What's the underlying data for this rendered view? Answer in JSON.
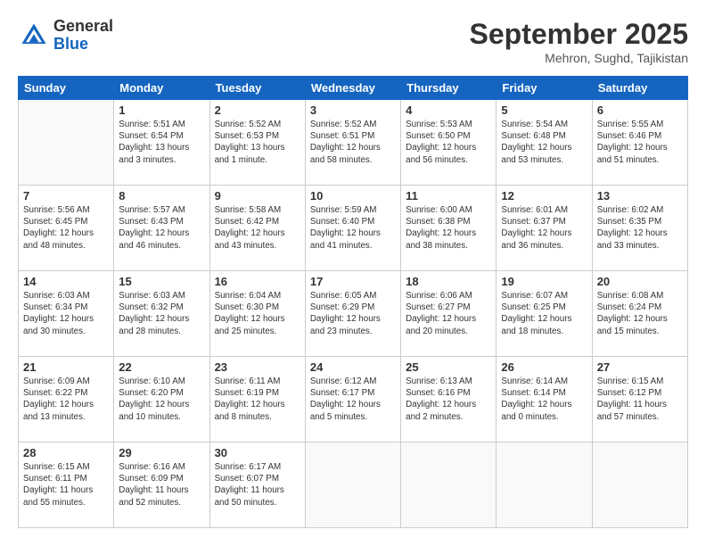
{
  "header": {
    "logo_general": "General",
    "logo_blue": "Blue",
    "month_title": "September 2025",
    "location": "Mehron, Sughd, Tajikistan"
  },
  "days_of_week": [
    "Sunday",
    "Monday",
    "Tuesday",
    "Wednesday",
    "Thursday",
    "Friday",
    "Saturday"
  ],
  "weeks": [
    [
      {
        "day": "",
        "info": ""
      },
      {
        "day": "1",
        "info": "Sunrise: 5:51 AM\nSunset: 6:54 PM\nDaylight: 13 hours\nand 3 minutes."
      },
      {
        "day": "2",
        "info": "Sunrise: 5:52 AM\nSunset: 6:53 PM\nDaylight: 13 hours\nand 1 minute."
      },
      {
        "day": "3",
        "info": "Sunrise: 5:52 AM\nSunset: 6:51 PM\nDaylight: 12 hours\nand 58 minutes."
      },
      {
        "day": "4",
        "info": "Sunrise: 5:53 AM\nSunset: 6:50 PM\nDaylight: 12 hours\nand 56 minutes."
      },
      {
        "day": "5",
        "info": "Sunrise: 5:54 AM\nSunset: 6:48 PM\nDaylight: 12 hours\nand 53 minutes."
      },
      {
        "day": "6",
        "info": "Sunrise: 5:55 AM\nSunset: 6:46 PM\nDaylight: 12 hours\nand 51 minutes."
      }
    ],
    [
      {
        "day": "7",
        "info": "Sunrise: 5:56 AM\nSunset: 6:45 PM\nDaylight: 12 hours\nand 48 minutes."
      },
      {
        "day": "8",
        "info": "Sunrise: 5:57 AM\nSunset: 6:43 PM\nDaylight: 12 hours\nand 46 minutes."
      },
      {
        "day": "9",
        "info": "Sunrise: 5:58 AM\nSunset: 6:42 PM\nDaylight: 12 hours\nand 43 minutes."
      },
      {
        "day": "10",
        "info": "Sunrise: 5:59 AM\nSunset: 6:40 PM\nDaylight: 12 hours\nand 41 minutes."
      },
      {
        "day": "11",
        "info": "Sunrise: 6:00 AM\nSunset: 6:38 PM\nDaylight: 12 hours\nand 38 minutes."
      },
      {
        "day": "12",
        "info": "Sunrise: 6:01 AM\nSunset: 6:37 PM\nDaylight: 12 hours\nand 36 minutes."
      },
      {
        "day": "13",
        "info": "Sunrise: 6:02 AM\nSunset: 6:35 PM\nDaylight: 12 hours\nand 33 minutes."
      }
    ],
    [
      {
        "day": "14",
        "info": "Sunrise: 6:03 AM\nSunset: 6:34 PM\nDaylight: 12 hours\nand 30 minutes."
      },
      {
        "day": "15",
        "info": "Sunrise: 6:03 AM\nSunset: 6:32 PM\nDaylight: 12 hours\nand 28 minutes."
      },
      {
        "day": "16",
        "info": "Sunrise: 6:04 AM\nSunset: 6:30 PM\nDaylight: 12 hours\nand 25 minutes."
      },
      {
        "day": "17",
        "info": "Sunrise: 6:05 AM\nSunset: 6:29 PM\nDaylight: 12 hours\nand 23 minutes."
      },
      {
        "day": "18",
        "info": "Sunrise: 6:06 AM\nSunset: 6:27 PM\nDaylight: 12 hours\nand 20 minutes."
      },
      {
        "day": "19",
        "info": "Sunrise: 6:07 AM\nSunset: 6:25 PM\nDaylight: 12 hours\nand 18 minutes."
      },
      {
        "day": "20",
        "info": "Sunrise: 6:08 AM\nSunset: 6:24 PM\nDaylight: 12 hours\nand 15 minutes."
      }
    ],
    [
      {
        "day": "21",
        "info": "Sunrise: 6:09 AM\nSunset: 6:22 PM\nDaylight: 12 hours\nand 13 minutes."
      },
      {
        "day": "22",
        "info": "Sunrise: 6:10 AM\nSunset: 6:20 PM\nDaylight: 12 hours\nand 10 minutes."
      },
      {
        "day": "23",
        "info": "Sunrise: 6:11 AM\nSunset: 6:19 PM\nDaylight: 12 hours\nand 8 minutes."
      },
      {
        "day": "24",
        "info": "Sunrise: 6:12 AM\nSunset: 6:17 PM\nDaylight: 12 hours\nand 5 minutes."
      },
      {
        "day": "25",
        "info": "Sunrise: 6:13 AM\nSunset: 6:16 PM\nDaylight: 12 hours\nand 2 minutes."
      },
      {
        "day": "26",
        "info": "Sunrise: 6:14 AM\nSunset: 6:14 PM\nDaylight: 12 hours\nand 0 minutes."
      },
      {
        "day": "27",
        "info": "Sunrise: 6:15 AM\nSunset: 6:12 PM\nDaylight: 11 hours\nand 57 minutes."
      }
    ],
    [
      {
        "day": "28",
        "info": "Sunrise: 6:15 AM\nSunset: 6:11 PM\nDaylight: 11 hours\nand 55 minutes."
      },
      {
        "day": "29",
        "info": "Sunrise: 6:16 AM\nSunset: 6:09 PM\nDaylight: 11 hours\nand 52 minutes."
      },
      {
        "day": "30",
        "info": "Sunrise: 6:17 AM\nSunset: 6:07 PM\nDaylight: 11 hours\nand 50 minutes."
      },
      {
        "day": "",
        "info": ""
      },
      {
        "day": "",
        "info": ""
      },
      {
        "day": "",
        "info": ""
      },
      {
        "day": "",
        "info": ""
      }
    ]
  ]
}
